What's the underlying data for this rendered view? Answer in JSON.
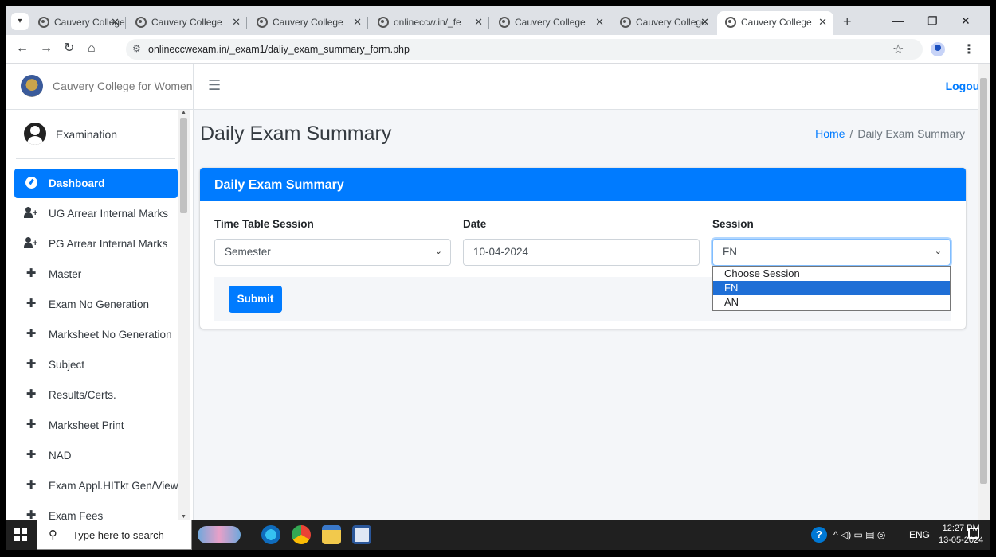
{
  "browser": {
    "tabs": [
      {
        "title": "Cauvery College",
        "close": "✕"
      },
      {
        "title": "Cauvery College",
        "close": "✕"
      },
      {
        "title": "Cauvery College",
        "close": "✕"
      },
      {
        "title": "onlineccw.in/_fe",
        "close": "✕"
      },
      {
        "title": "Cauvery College",
        "close": "✕"
      },
      {
        "title": "Cauvery College",
        "close": "✕"
      },
      {
        "title": "Cauvery College",
        "close": "✕"
      }
    ],
    "active_tab": 6,
    "new_tab": "+",
    "url": "onlineccwexam.in/_exam1/daliy_exam_summary_form.php"
  },
  "brand": {
    "name": "Cauvery College for Women"
  },
  "user": {
    "name": "Examination"
  },
  "sidebar": {
    "items": [
      {
        "label": "Dashboard",
        "icon": "dashboard-icon"
      },
      {
        "label": "UG Arrear Internal Marks",
        "icon": "user-plus-icon"
      },
      {
        "label": "PG Arrear Internal Marks",
        "icon": "user-plus-icon"
      },
      {
        "label": "Master",
        "icon": "plus-icon"
      },
      {
        "label": "Exam No Generation",
        "icon": "plus-icon"
      },
      {
        "label": "Marksheet No Generation",
        "icon": "plus-icon"
      },
      {
        "label": "Subject",
        "icon": "plus-icon"
      },
      {
        "label": "Results/Certs.",
        "icon": "plus-icon"
      },
      {
        "label": "Marksheet Print",
        "icon": "plus-icon"
      },
      {
        "label": "NAD",
        "icon": "plus-icon"
      },
      {
        "label": "Exam Appl.HITkt Gen/View",
        "icon": "plus-icon"
      },
      {
        "label": "Exam Fees",
        "icon": "plus-icon"
      }
    ]
  },
  "topnav": {
    "logout": "Logout"
  },
  "page": {
    "title": "Daily Exam Summary",
    "breadcrumb": {
      "home": "Home",
      "current": "Daily Exam Summary"
    }
  },
  "form": {
    "card_title": "Daily Exam Summary",
    "time_table_session": {
      "label": "Time Table Session",
      "value": "Semester"
    },
    "date": {
      "label": "Date",
      "value": "10-04-2024"
    },
    "session": {
      "label": "Session",
      "value": "FN",
      "options": [
        "Choose Session",
        "FN",
        "AN"
      ],
      "selected_index": 1
    },
    "submit": "Submit"
  },
  "taskbar": {
    "search_placeholder": "Type here to search",
    "tray_lang": "ENG",
    "time": "12:27 PM",
    "date": "13-05-2024"
  },
  "colors": {
    "primary": "#007bff",
    "sidebar_active": "#007bff",
    "taskbar": "#202020"
  }
}
